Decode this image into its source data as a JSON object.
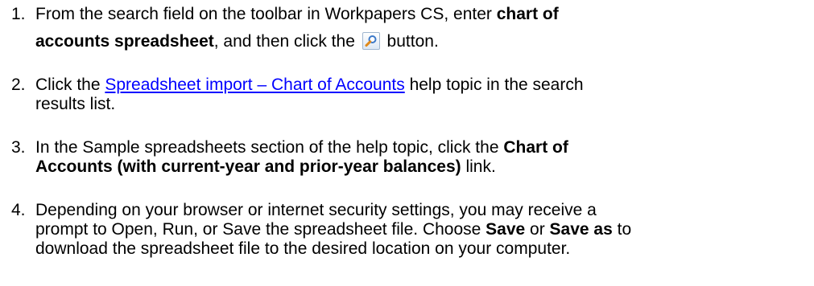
{
  "steps": [
    {
      "number": "1.",
      "line1_text": "From the search field on the toolbar in Workpapers CS, enter ",
      "line1_bold": "chart of",
      "line2_bold": "accounts spreadsheet",
      "line2_text": ", and then click the",
      "button_icon": "search-icon",
      "line2_tail": " button."
    },
    {
      "number": "2.",
      "prefix": "Click the ",
      "link_text": "Spreadsheet import – Chart of Accounts",
      "suffix": " help topic in the search",
      "line2": "results list."
    },
    {
      "number": "3.",
      "line1_text": "In the Sample spreadsheets section of the help topic, click the ",
      "line1_bold": "Chart of",
      "line2_bold": "Accounts (with current-year and prior-year balances)",
      "line2_tail": " link."
    },
    {
      "number": "4.",
      "line1": "Depending on your browser or internet security settings, you may receive a",
      "line2_text": "prompt to Open, Run, or Save the spreadsheet file. Choose ",
      "bold_save": "Save",
      "or_text": " or ",
      "bold_save_as": "Save as",
      "to_text": " to",
      "line3": "download the spreadsheet file to the desired location on your computer."
    }
  ],
  "colors": {
    "link": "#0000ff",
    "text": "#000000",
    "icon_accent": "#3a78c8"
  }
}
